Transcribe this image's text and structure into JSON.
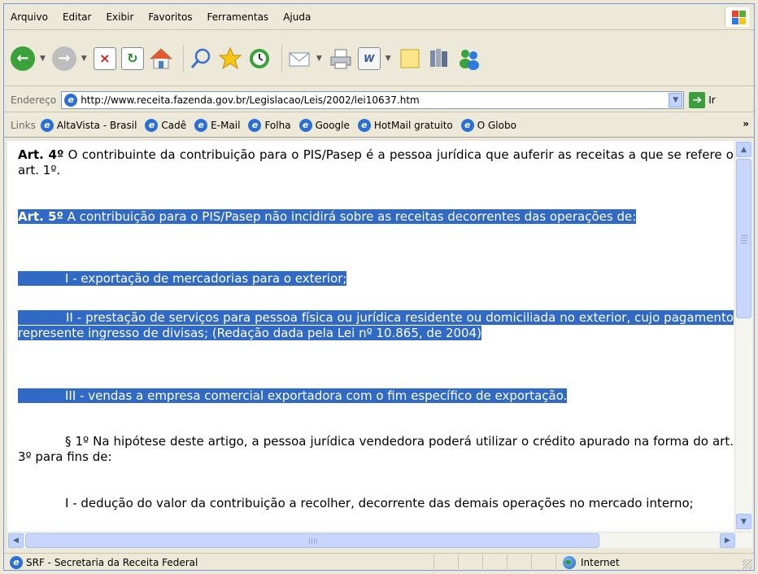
{
  "menu": [
    "Arquivo",
    "Editar",
    "Exibir",
    "Favoritos",
    "Ferramentas",
    "Ajuda"
  ],
  "address": {
    "label": "Endereço",
    "url": "http://www.receita.fazenda.gov.br/Legislacao/Leis/2002/lei10637.htm",
    "go_label": "Ir"
  },
  "links": {
    "label": "Links",
    "items": [
      "AltaVista - Brasil",
      "Cadê",
      "E-Mail",
      "Folha",
      "Google",
      "HotMail gratuito",
      "O Globo"
    ]
  },
  "content": {
    "art4_label": "Art. 4º",
    "art4_text": " O contribuinte da contribuição para o PIS/Pasep é a pessoa jurídica que auferir as receitas a que se refere o art. 1º.",
    "art5_label": "Art. 5º",
    "art5_text": " A contribuição para o PIS/Pasep não incidirá sobre as receitas decorrentes das operações de:",
    "item_i": "I - exportação de mercadorias para o exterior;",
    "item_ii": "II - prestação de serviços para pessoa física ou jurídica residente ou domiciliada no exterior, cujo pagamento represente ingresso de divisas; (Redação dada pela Lei nº 10.865, de 2004)",
    "item_iii": "III - vendas a empresa comercial exportadora com o fim específico de exportação.",
    "par1": "§ 1º Na hipótese deste artigo, a pessoa jurídica vendedora poderá utilizar o crédito apurado na forma do art. 3º para fins de:",
    "par1_i": "I - dedução do valor da contribuição a recolher, decorrente das demais operações no mercado interno;"
  },
  "status": {
    "text": "SRF - Secretaria da Receita Federal",
    "zone": "Internet"
  },
  "colors": {
    "selection": "#316ac5",
    "chrome": "#ece9d8"
  }
}
